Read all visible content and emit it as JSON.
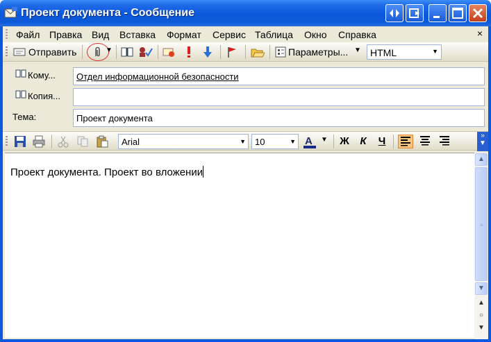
{
  "window": {
    "title": "Проект документа - Сообщение",
    "controls": [
      "system-menu-icon",
      "minimize-icon",
      "maximize-icon",
      "close-icon"
    ]
  },
  "menu": {
    "items": [
      "Файл",
      "Правка",
      "Вид",
      "Вставка",
      "Формат",
      "Сервис",
      "Таблица",
      "Окно",
      "Справка"
    ],
    "close_glyph": "×"
  },
  "toolbar": {
    "send_label": "Отправить",
    "options_label": "Параметры...",
    "format_value": "HTML",
    "icons": [
      "send-icon",
      "paperclip-icon",
      "address-book-icon",
      "check-names-icon",
      "signature-icon",
      "high-importance-icon",
      "low-importance-icon",
      "flag-icon",
      "open-folder-icon",
      "options-icon"
    ]
  },
  "header": {
    "to_label": "Кому...",
    "to_value": "Отдел информационной безопасности",
    "cc_label": "Копия...",
    "cc_value": "",
    "subject_label": "Тема:",
    "subject_value": "Проект документа"
  },
  "format_toolbar": {
    "font": "Arial",
    "size": "10",
    "bold": "Ж",
    "italic": "К",
    "underline": "Ч",
    "icons": [
      "save-icon",
      "print-icon",
      "cut-icon",
      "copy-icon",
      "paste-icon",
      "font-color-icon",
      "align-left-icon",
      "align-center-icon",
      "align-right-icon"
    ]
  },
  "body": {
    "text": "Проект документа. Проект во вложении"
  },
  "colors": {
    "titlebar": "#0a58dc",
    "chrome": "#ece9d8",
    "highlight": "#fbc67f"
  }
}
